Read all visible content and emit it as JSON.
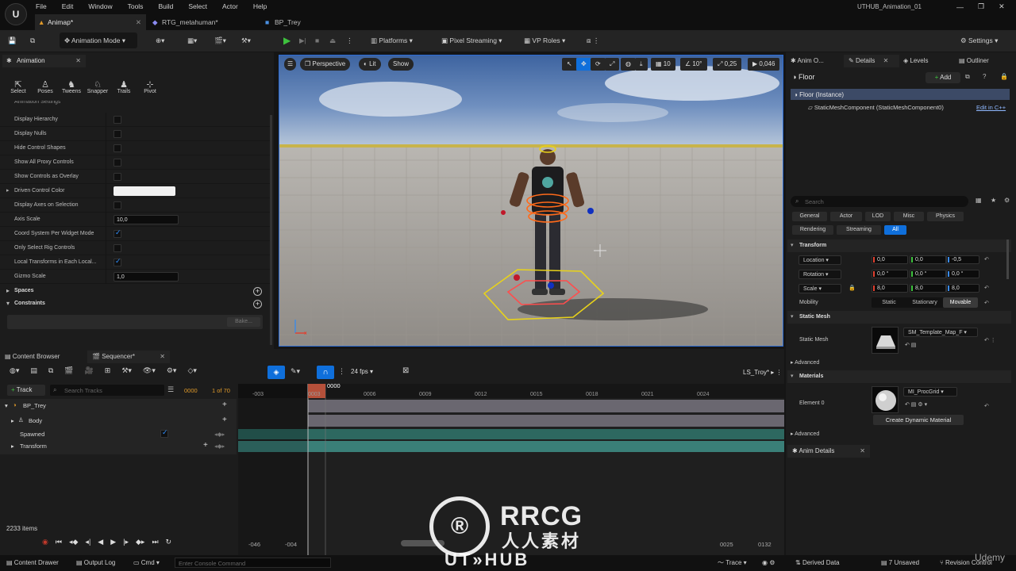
{
  "app": {
    "logo": "U",
    "project": "UTHUB_Animation_01"
  },
  "menu": [
    "File",
    "Edit",
    "Window",
    "Tools",
    "Build",
    "Select",
    "Actor",
    "Help"
  ],
  "doc_tabs": [
    "Animap*",
    "RTG_metahuman*",
    "BP_Trey"
  ],
  "toolbar": {
    "mode": "Animation Mode",
    "platforms": "Platforms",
    "pixel_streaming": "Pixel Streaming",
    "vp_roles": "VP Roles",
    "settings": "Settings"
  },
  "anim_panel": {
    "tab": "Animation",
    "tools": [
      "Select",
      "Poses",
      "Tweens",
      "Snapper",
      "Trails",
      "Pivot"
    ],
    "section_header": "Animation Settings",
    "props": [
      {
        "label": "Display Hierarchy",
        "kind": "check",
        "on": false
      },
      {
        "label": "Display Nulls",
        "kind": "check",
        "on": false
      },
      {
        "label": "Hide Control Shapes",
        "kind": "check",
        "on": false
      },
      {
        "label": "Show All Proxy Controls",
        "kind": "check",
        "on": false
      },
      {
        "label": "Show Controls as Overlay",
        "kind": "check",
        "on": false
      },
      {
        "label": "Driven Control Color",
        "kind": "color",
        "on": false
      },
      {
        "label": "Display Axes on Selection",
        "kind": "check",
        "on": false
      },
      {
        "label": "Axis Scale",
        "kind": "num",
        "value": "10,0"
      },
      {
        "label": "Coord System Per Widget Mode",
        "kind": "check",
        "on": true
      },
      {
        "label": "Only Select Rig Controls",
        "kind": "check",
        "on": false
      },
      {
        "label": "Local Transforms in Each Local...",
        "kind": "check",
        "on": true
      },
      {
        "label": "Gizmo Scale",
        "kind": "num",
        "value": "1,0"
      }
    ],
    "spaces": "Spaces",
    "constraints": "Constraints",
    "bake": "Bake..."
  },
  "viewport": {
    "perspective": "Perspective",
    "lit": "Lit",
    "show": "Show",
    "grid": "10",
    "angle": "10°",
    "scale": "0,25",
    "speed": "0,046"
  },
  "right_tabs": [
    "Anim O...",
    "Details",
    "Levels",
    "Outliner"
  ],
  "details": {
    "actor": "Floor",
    "add": "Add",
    "instance": "Floor (Instance)",
    "component": "StaticMeshComponent (StaticMeshComponent0)",
    "edit_cpp": "Edit in C++",
    "search_placeholder": "Search",
    "filters": [
      "General",
      "Actor",
      "LOD",
      "Misc",
      "Physics",
      "Rendering",
      "Streaming",
      "All"
    ],
    "transform": "Transform",
    "location": {
      "label": "Location",
      "x": "0,0",
      "y": "0,0",
      "z": "-0,5"
    },
    "rotation": {
      "label": "Rotation",
      "x": "0,0 °",
      "y": "0,0 °",
      "z": "0,0 °"
    },
    "scale": {
      "label": "Scale",
      "x": "8,0",
      "y": "8,0",
      "z": "8,0"
    },
    "mobility": {
      "label": "Mobility",
      "options": [
        "Static",
        "Stationary",
        "Movable"
      ],
      "selected": "Movable"
    },
    "static_mesh_section": "Static Mesh",
    "static_mesh_label": "Static Mesh",
    "static_mesh_value": "SM_Template_Map_F",
    "advanced": "Advanced",
    "materials": "Materials",
    "element0": "Element 0",
    "material_value": "MI_ProcGrid",
    "create_dynamic": "Create Dynamic Material",
    "advanced2": "Advanced"
  },
  "anim_details": {
    "tab": "Anim Details"
  },
  "bottom_tabs": [
    "Content Browser",
    "Sequencer*"
  ],
  "sequencer": {
    "fps": "24 fps",
    "sequence": "LS_Troy*",
    "add_track": "Track",
    "search_placeholder": "Search Tracks",
    "frame": "0000",
    "frame_of": "1 of 70",
    "playhead": "0000",
    "ticks": [
      "-003",
      "0003",
      "0006",
      "0009",
      "0012",
      "0015",
      "0018",
      "0021",
      "0024"
    ],
    "tracks": [
      "BP_Trey",
      "Body",
      "Spawned",
      "Transform"
    ],
    "items": "2233 items",
    "range_start": "-046",
    "range_start2": "-004",
    "range_end": "0025",
    "range_end2": "0132"
  },
  "statusbar": {
    "content_drawer": "Content Drawer",
    "output_log": "Output Log",
    "cmd": "Cmd",
    "console_placeholder": "Enter Console Command",
    "trace": "Trace",
    "derived": "Derived Data",
    "unsaved": "7 Unsaved",
    "revision": "Revision Control"
  },
  "watermark": {
    "brand": "RRCG",
    "cn": "人人素材",
    "sub": "UT»HUB",
    "udemy": "Udemy"
  },
  "colors": {
    "accent": "#0f6fdb",
    "play": "#3ec23e",
    "selection_yellow": "#f0e000",
    "record_red": "#c0392b",
    "playhead": "#b5503a"
  }
}
